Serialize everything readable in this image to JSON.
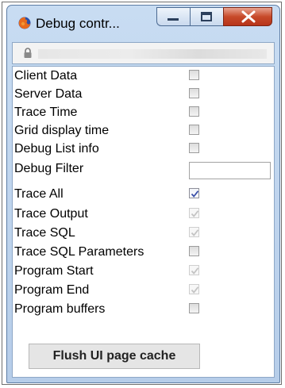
{
  "window": {
    "title": "Debug contr...",
    "icon": "firefox-icon",
    "caption_buttons": [
      "minimize-icon",
      "maximize-icon",
      "close-icon"
    ]
  },
  "address_bar": {
    "icon": "lock-icon"
  },
  "options": [
    {
      "label": "Client Data",
      "control": "checkbox",
      "checked": false,
      "disabled": false
    },
    {
      "label": "Server Data",
      "control": "checkbox",
      "checked": false,
      "disabled": false
    },
    {
      "label": "Trace Time",
      "control": "checkbox",
      "checked": false,
      "disabled": false
    },
    {
      "label": "Grid display time",
      "control": "checkbox",
      "checked": false,
      "disabled": false
    },
    {
      "label": "Debug List info",
      "control": "checkbox",
      "checked": false,
      "disabled": false
    },
    {
      "label": "Debug Filter",
      "control": "text",
      "value": ""
    },
    {
      "label": "Trace All",
      "control": "checkbox",
      "checked": true,
      "disabled": false
    },
    {
      "label": "Trace Output",
      "control": "checkbox",
      "checked": true,
      "disabled": true
    },
    {
      "label": "Trace SQL",
      "control": "checkbox",
      "checked": true,
      "disabled": true
    },
    {
      "label": "Trace SQL Parameters",
      "control": "checkbox",
      "checked": false,
      "disabled": false
    },
    {
      "label": "Program Start",
      "control": "checkbox",
      "checked": true,
      "disabled": true
    },
    {
      "label": "Program End",
      "control": "checkbox",
      "checked": true,
      "disabled": true
    },
    {
      "label": "Program buffers",
      "control": "checkbox",
      "checked": false,
      "disabled": false
    }
  ],
  "flush_button": {
    "label": "Flush UI page cache"
  },
  "colors": {
    "check_active": "#3a4fa8",
    "check_disabled": "#c4c4c4"
  }
}
